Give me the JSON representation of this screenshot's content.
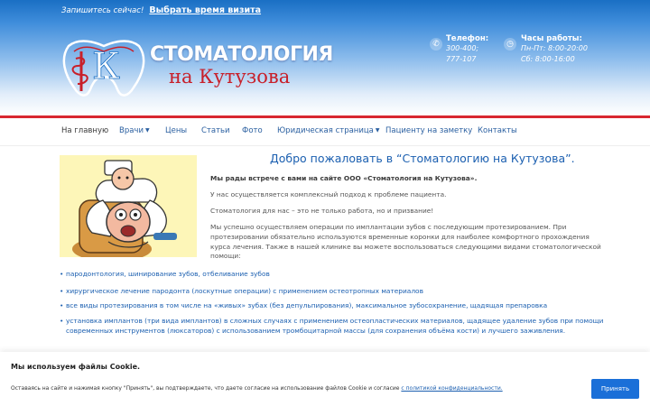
{
  "topbar": {
    "invite": "Запишитесь сейчас!",
    "visit_link": "Выбрать время визита"
  },
  "brand": {
    "line1": "СТОМАТОЛОГИЯ",
    "line2": "на Кутузова",
    "logo_letter": "К",
    "colors": {
      "red": "#c8202a",
      "blue": "#1a6fc4"
    }
  },
  "contacts": {
    "phone_title": "Телефон:",
    "phone_1": "300-400;",
    "phone_2": "777-107",
    "hours_title": "Часы работы:",
    "hours_1": "Пн-Пт: 8:00-20:00",
    "hours_2": "Сб: 8:00-16:00",
    "phone_icon": "phone-icon",
    "clock_icon": "clock-icon"
  },
  "nav": {
    "items": [
      {
        "label": "На главную",
        "active": true
      },
      {
        "label": "Врачи",
        "dropdown": true
      },
      {
        "label": "Цены"
      },
      {
        "label": "Статьи"
      },
      {
        "label": "Фото"
      },
      {
        "label": "Юридическая страница",
        "dropdown": true
      },
      {
        "label": "Пациенту на заметку"
      },
      {
        "label": "Контакты"
      }
    ],
    "caret": "▼"
  },
  "main": {
    "heading": "Добро пожаловать в “Стоматологию на Кутузова”.",
    "p1": "Мы рады встрече с вами на сайте ООО «Стоматология на Кутузова».",
    "p2": "У нас осуществляется комплексный подход к проблеме пациента.",
    "p3": "Стоматология для нас – это не только работа, но и призвание!",
    "p4": "Мы успешно осуществляем операции по имплантации зубов с последующим протезированием. При протезировании обязательно используются временные коронки для наиболее комфортного прохождения курса лечения. Также в нашей клинике вы можете воспользоваться следующими видами стоматологической помощи:",
    "bullets": [
      "пародонтология, шинирование зубов, отбеливание зубов",
      "хирургическое лечение пародонта (лоскутные операции) с применением остеотропных материалов",
      "все виды протезирования в том числе на «живых» зубах (без депульпирования), максимальное зубосохранение, щадящая препаровка",
      "установка имплантов (три вида имплантов) в сложных случаях с применением остеопластических материалов, щадящее удаление зубов при помощи современных инструментов (люксаторов) с использованием тромбоцитарной массы (для сохранения объёма кости) и лучшего заживления."
    ]
  },
  "cookie": {
    "title": "Мы используем файлы Cookie.",
    "text": "Оставаясь на сайте и нажимая кнопку \"Принять\", вы подтверждаете, что даете согласие на использование файлов Cookie и согласие",
    "link": "с политикой конфиденциальности.",
    "accept": "Принять"
  }
}
